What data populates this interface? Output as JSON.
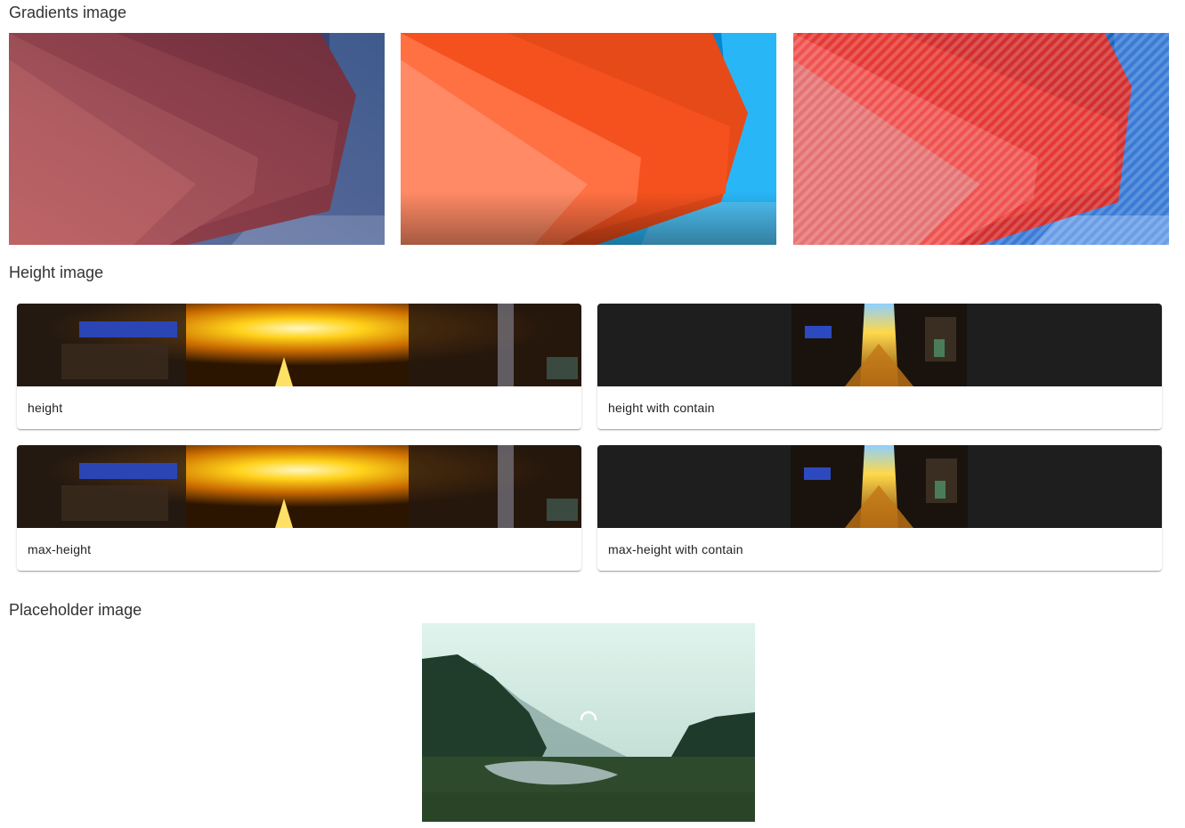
{
  "sections": {
    "gradients": "Gradients image",
    "height": "Height image",
    "placeholder": "Placeholder image"
  },
  "cards": [
    {
      "title": "height"
    },
    {
      "title": "height with contain"
    },
    {
      "title": "max-height"
    },
    {
      "title": "max-height with contain"
    }
  ],
  "colors": {
    "card_dark_bg": "#1e1e1e",
    "overlay_red": "#c62828",
    "overlay_orange": "#f4511e",
    "stripe_red": "#e53935"
  }
}
